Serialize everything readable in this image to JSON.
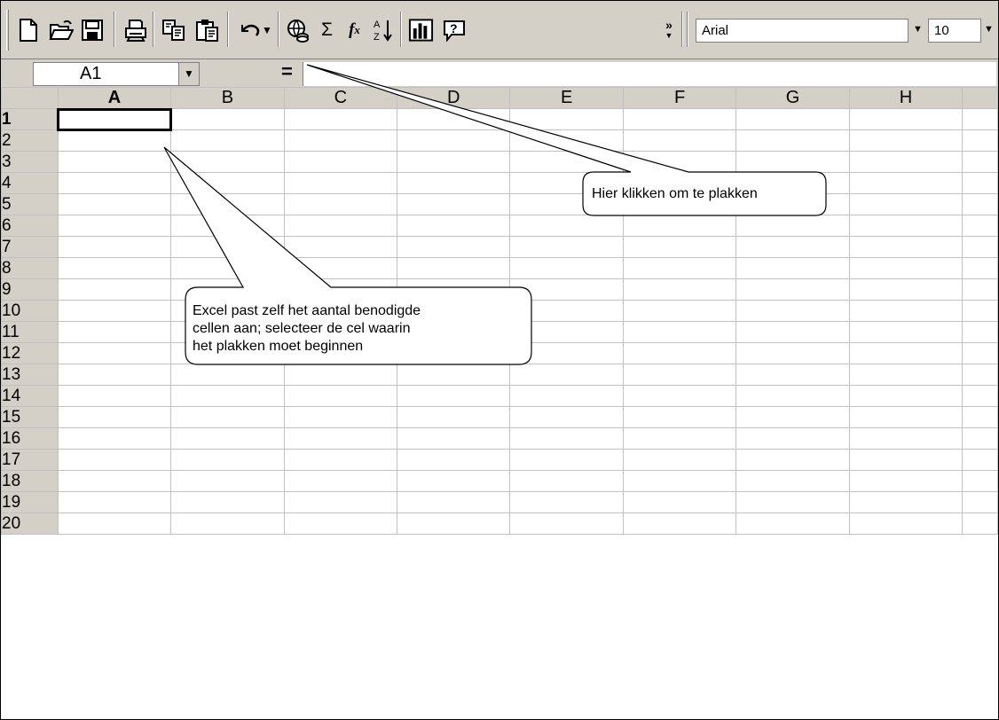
{
  "toolbar": {
    "buttons": [
      {
        "name": "new-icon",
        "glyph": "new"
      },
      {
        "name": "open-icon",
        "glyph": "open"
      },
      {
        "name": "save-icon",
        "glyph": "save"
      },
      {
        "name": "print-icon",
        "glyph": "print"
      },
      {
        "name": "copy-icon",
        "glyph": "copy"
      },
      {
        "name": "paste-icon",
        "glyph": "paste"
      },
      {
        "name": "undo-icon",
        "glyph": "undo"
      },
      {
        "name": "hyperlink-icon",
        "glyph": "hyperlink"
      },
      {
        "name": "autosum-icon",
        "glyph": "Σ"
      },
      {
        "name": "function-icon",
        "glyph": "fx"
      },
      {
        "name": "sort-ascending-icon",
        "glyph": "sort"
      },
      {
        "name": "chart-wizard-icon",
        "glyph": "chart"
      },
      {
        "name": "help-icon",
        "glyph": "?"
      }
    ],
    "font_name": "Arial",
    "font_size": "10"
  },
  "formula_bar": {
    "name_box": "A1",
    "equals": "=",
    "value": ""
  },
  "grid": {
    "columns": [
      "A",
      "B",
      "C",
      "D",
      "E",
      "F",
      "G",
      "H"
    ],
    "rows": [
      "1",
      "2",
      "3",
      "4",
      "5",
      "6",
      "7",
      "8",
      "9",
      "10",
      "11",
      "12",
      "13",
      "14",
      "15",
      "16",
      "17",
      "18",
      "19",
      "20"
    ],
    "active_cell": "A1"
  },
  "callouts": {
    "paste_hint": "Hier klikken om te plakken",
    "cell_hint": {
      "line1": "Excel past zelf het aantal benodigde",
      "line2": "cellen aan; selecteer de cel waarin",
      "line3": "het plakken moet beginnen"
    }
  }
}
